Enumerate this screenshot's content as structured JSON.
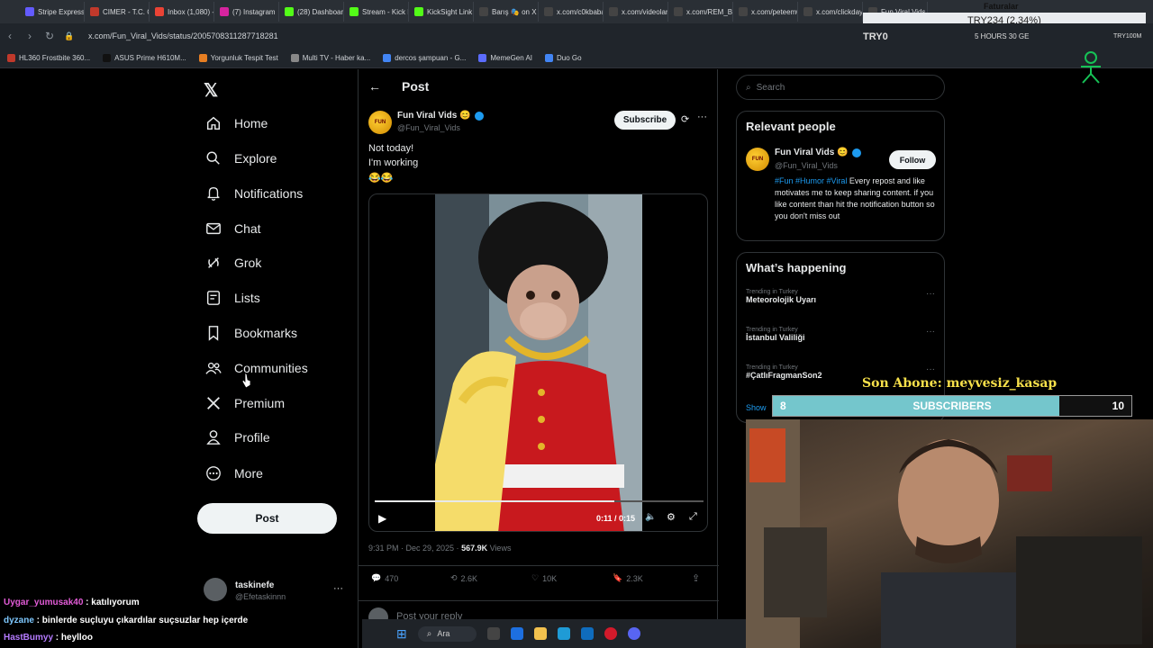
{
  "browser": {
    "tabs": [
      {
        "label": "Stripe Express",
        "color": "#635bff"
      },
      {
        "label": "CIMER - T.C. C",
        "color": "#c0392b"
      },
      {
        "label": "Inbox (1,080) -",
        "color": "#ea4335"
      },
      {
        "label": "(7) Instagram",
        "color": "#d6249f"
      },
      {
        "label": "(28) Dashboard",
        "color": "#53fc18"
      },
      {
        "label": "Stream - Kick D",
        "color": "#53fc18"
      },
      {
        "label": "KickSight Link D",
        "color": "#53fc18"
      },
      {
        "label": "Barış 🎭 on X",
        "color": "#444"
      },
      {
        "label": "x.com/c0kbaba",
        "color": "#444"
      },
      {
        "label": "x.com/videolar",
        "color": "#444"
      },
      {
        "label": "x.com/REM_B",
        "color": "#444"
      },
      {
        "label": "x.com/peteem0",
        "color": "#444"
      },
      {
        "label": "x.com/clickday",
        "color": "#444"
      },
      {
        "label": "Fun Viral Vids",
        "color": "#444"
      }
    ],
    "url": "x.com/Fun_Viral_Vids/status/2005708311287718281",
    "bookmarks": [
      {
        "label": "HL360 Frostbite 360...",
        "color": "#c0392b"
      },
      {
        "label": "ASUS Prime H610M...",
        "color": "#111"
      },
      {
        "label": "Yorgunluk Tespit Test",
        "color": "#e67e22"
      },
      {
        "label": "Multi TV - Haber ka...",
        "color": "#888"
      },
      {
        "label": "dercos şampuan - G...",
        "color": "#4285f4"
      },
      {
        "label": "MemeGen AI",
        "color": "#5b6cff"
      },
      {
        "label": "Duo Go",
        "color": "#4285f4"
      }
    ]
  },
  "overlay": {
    "faturalar": "Faturalar",
    "ticker": "TRY234 (2.34%)",
    "try_left": "TRY0",
    "hours": "5 HOURS 30 GE",
    "try_right": "TRY100M",
    "son_abone": "Son Abone: meyvesiz_kasap",
    "subs_current": "8",
    "subs_label": "SUBSCRIBERS",
    "subs_goal": "10",
    "subs_progress": 0.8
  },
  "nav": {
    "items": [
      {
        "label": "Home",
        "icon": "home-icon"
      },
      {
        "label": "Explore",
        "icon": "search-icon"
      },
      {
        "label": "Notifications",
        "icon": "bell-icon"
      },
      {
        "label": "Chat",
        "icon": "mail-icon"
      },
      {
        "label": "Grok",
        "icon": "grok-icon"
      },
      {
        "label": "Lists",
        "icon": "list-icon"
      },
      {
        "label": "Bookmarks",
        "icon": "bookmark-icon"
      },
      {
        "label": "Communities",
        "icon": "people-icon"
      },
      {
        "label": "Premium",
        "icon": "x-logo-icon"
      },
      {
        "label": "Profile",
        "icon": "person-icon"
      },
      {
        "label": "More",
        "icon": "more-circle-icon"
      }
    ],
    "post_label": "Post",
    "account": {
      "name": "taskinefe",
      "handle": "@Efetaskinnn"
    }
  },
  "post": {
    "header_title": "Post",
    "author_name": "Fun Viral Vids 😊",
    "author_handle": "@Fun_Viral_Vids",
    "subscribe_label": "Subscribe",
    "text_line1": "Not today!",
    "text_line2": "I'm working",
    "text_line3": "😂😂",
    "video_time": "0:11 / 0:15",
    "video_progress": 0.73,
    "meta_time": "9:31 PM · Dec 29, 2025 · ",
    "views_count": "567.9K",
    "views_label": " Views",
    "replies": "470",
    "reposts": "2.6K",
    "likes": "10K",
    "bookmarks": "2.3K",
    "reply_placeholder": "Post your reply"
  },
  "sidebar": {
    "search_placeholder": "Search",
    "relevant_title": "Relevant people",
    "person": {
      "name": "Fun Viral Vids 😊",
      "handle": "@Fun_Viral_Vids",
      "follow_label": "Follow",
      "hashtags": "#Fun #Humor #Viral",
      "bio": " Every repost and like motivates me to keep sharing content. if you like content than hit the notification button so you don't miss out"
    },
    "happening_title": "What’s happening",
    "trends": [
      {
        "context": "Trending in Turkey",
        "title": "Meteorolojik Uyarı"
      },
      {
        "context": "Trending in Turkey",
        "title": "İstanbul Valiliği"
      },
      {
        "context": "Trending in Turkey",
        "title": "#ÇatlıFragmanSon2"
      }
    ],
    "show_more": "Show"
  },
  "chat": [
    {
      "user": "Uygar_yumusak40",
      "message": " : katılıyorum",
      "color": "#e35cd8"
    },
    {
      "user": "dyzane",
      "message": " : binlerde suçluyu çıkardılar suçsuzlar hep içerde",
      "color": "#7ec8ff"
    },
    {
      "user": "HastBumyy",
      "message": " : heylloo",
      "color": "#b57bff"
    }
  ],
  "taskbar": {
    "search_label": "Ara"
  }
}
